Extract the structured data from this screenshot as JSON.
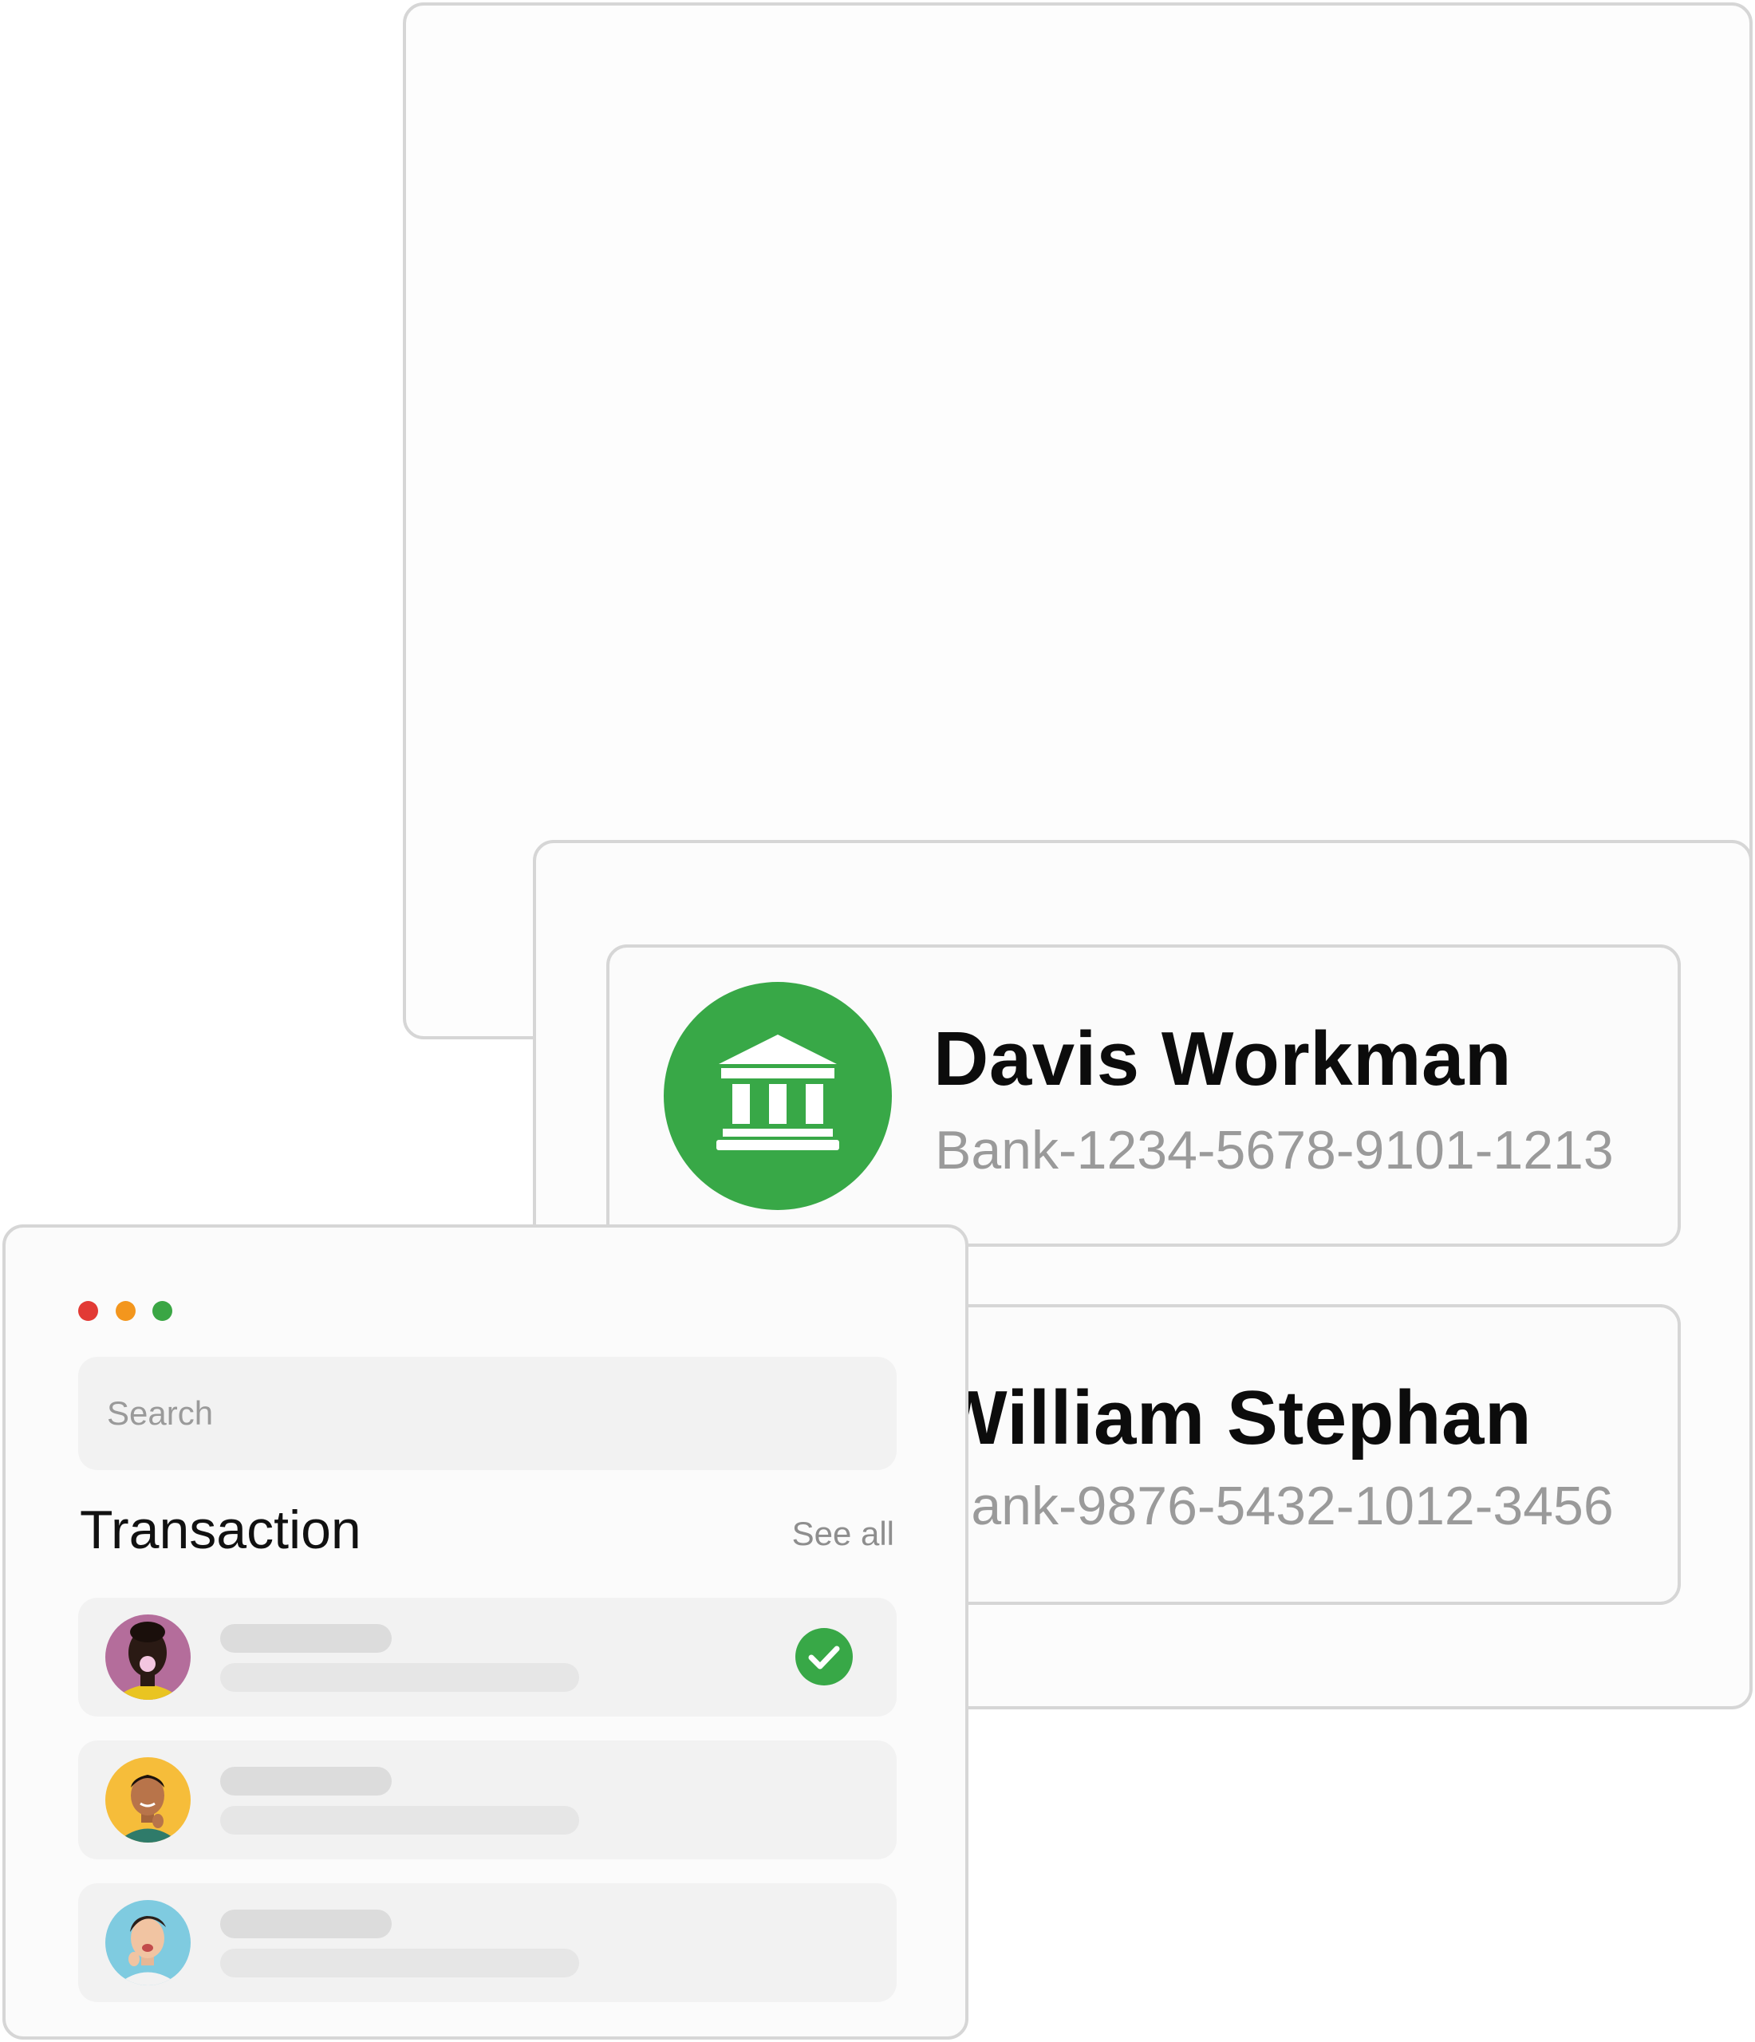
{
  "colors": {
    "accent_green": "#38a847",
    "border": "#d6d6d6",
    "window_red": "#e23a35",
    "window_orange": "#f3961d",
    "window_green": "#3aa644"
  },
  "accounts": [
    {
      "name": "Davis Workman",
      "number": "Bank-1234-5678-9101-1213",
      "icon": "bank-icon"
    },
    {
      "name": "William Stephan",
      "number": "Bank-9876-5432-1012-3456",
      "icon": "bank-icon"
    }
  ],
  "window": {
    "controls": [
      "close-dot",
      "minimize-dot",
      "maximize-dot"
    ]
  },
  "search": {
    "placeholder": "Search"
  },
  "transactions": {
    "title": "Transaction",
    "see_all_label": "See all",
    "rows": [
      {
        "avatar": "avatar-woman-bubblegum",
        "status_icon": "check-circle-icon"
      },
      {
        "avatar": "avatar-man-yellow"
      },
      {
        "avatar": "avatar-man-blue"
      }
    ]
  }
}
